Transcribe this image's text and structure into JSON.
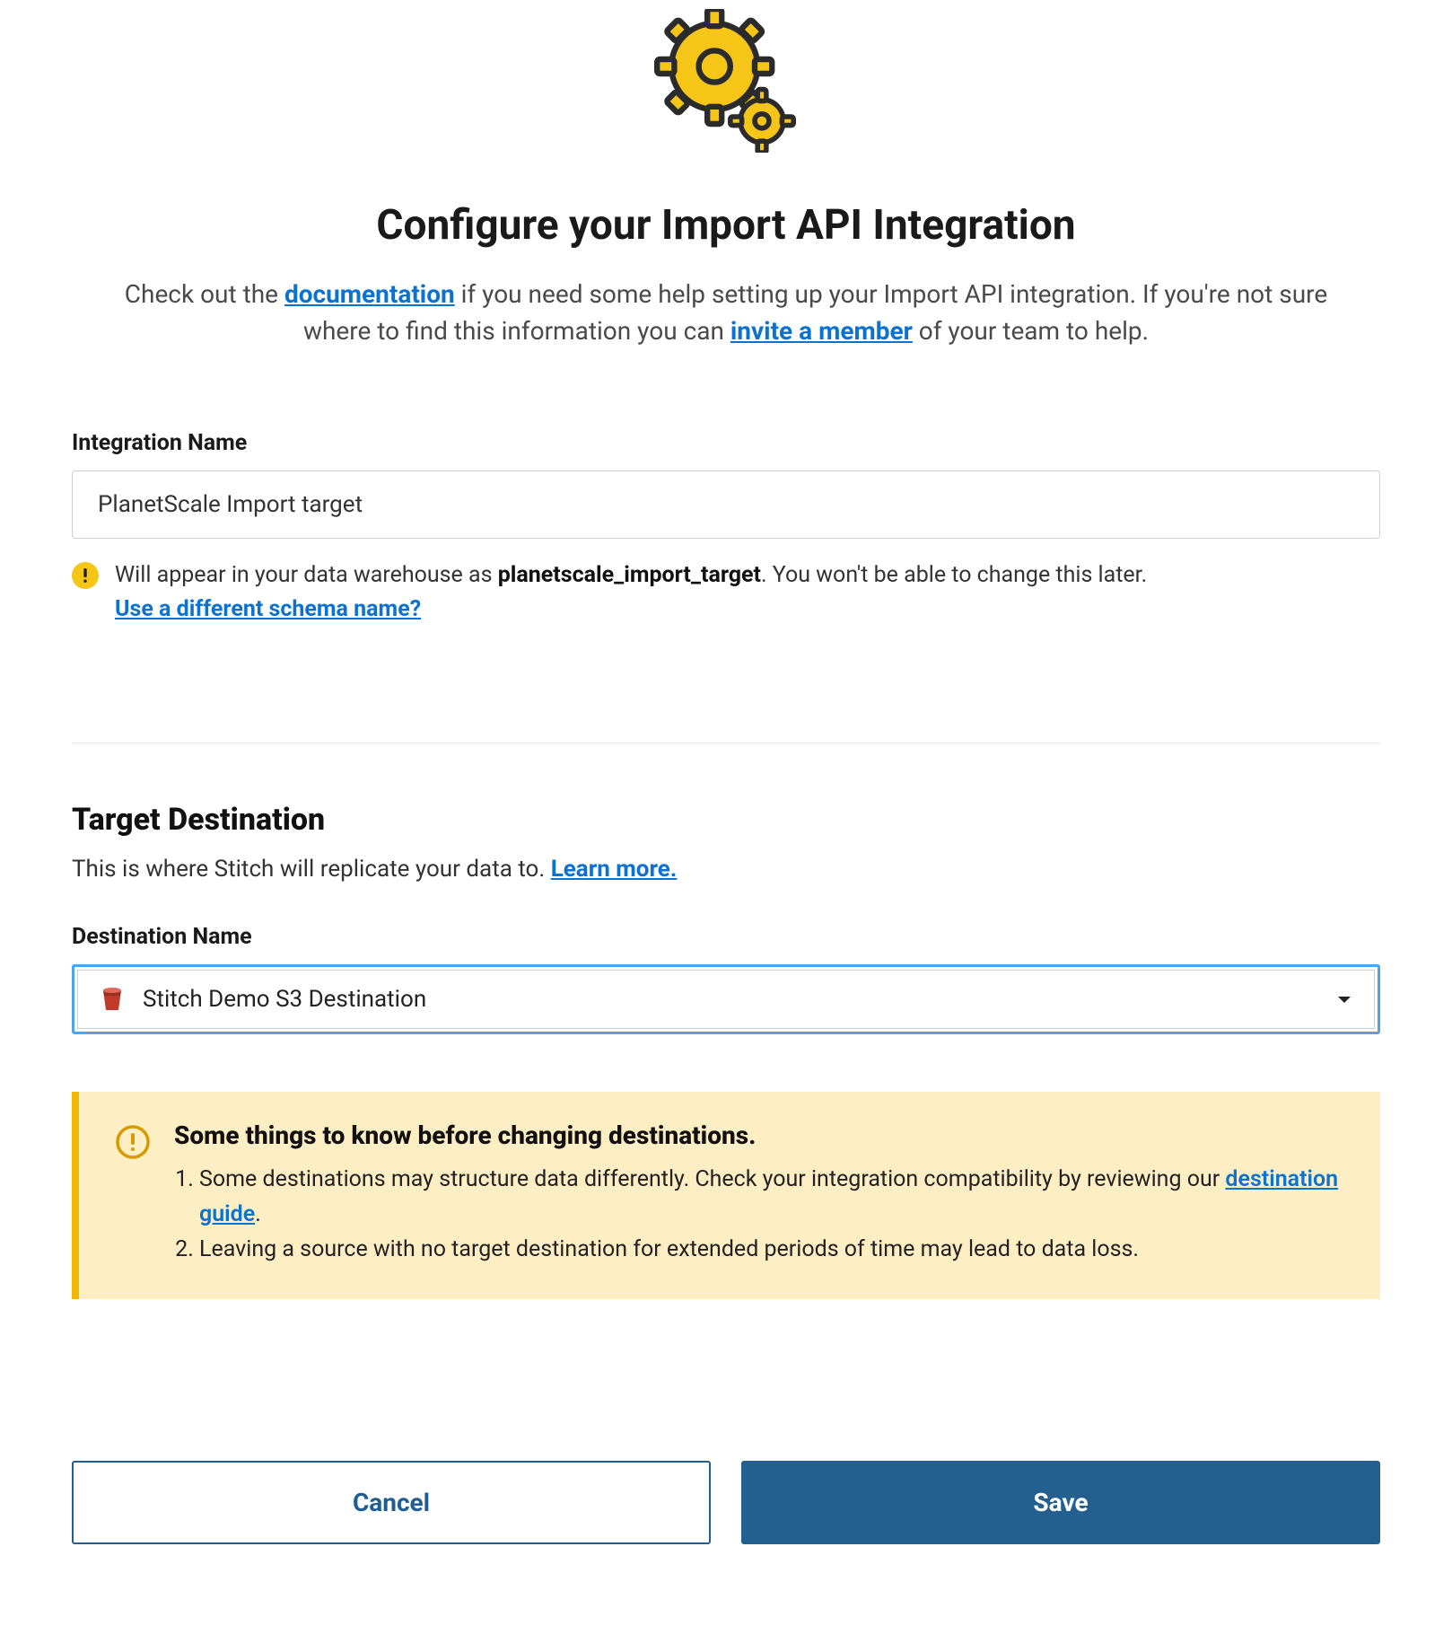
{
  "header": {
    "title": "Configure your Import API Integration",
    "intro_prefix": "Check out the ",
    "intro_doc_link": "documentation",
    "intro_mid": " if you need some help setting up your Import API integration. If you're not sure where to find this information you can ",
    "intro_invite_link": "invite a member",
    "intro_suffix": " of your team to help."
  },
  "integration": {
    "label": "Integration Name",
    "value": "PlanetScale Import target",
    "hint_prefix": "Will appear in your data warehouse as ",
    "hint_schema": "planetscale_import_target",
    "hint_suffix": ". You won't be able to change this later. ",
    "hint_link": "Use a different schema name?"
  },
  "destination": {
    "section_title": "Target Destination",
    "section_desc_prefix": "This is where Stitch will replicate your data to. ",
    "section_desc_link": "Learn more.",
    "label": "Destination Name",
    "selected": "Stitch Demo S3 Destination"
  },
  "callout": {
    "title": "Some things to know before changing destinations.",
    "item1_prefix": "Some destinations may structure data differently. Check your integration compatibility by reviewing our ",
    "item1_link": "destination guide",
    "item1_suffix": ".",
    "item2": "Leaving a source with no target destination for extended periods of time may lead to data loss."
  },
  "buttons": {
    "cancel": "Cancel",
    "save": "Save"
  }
}
